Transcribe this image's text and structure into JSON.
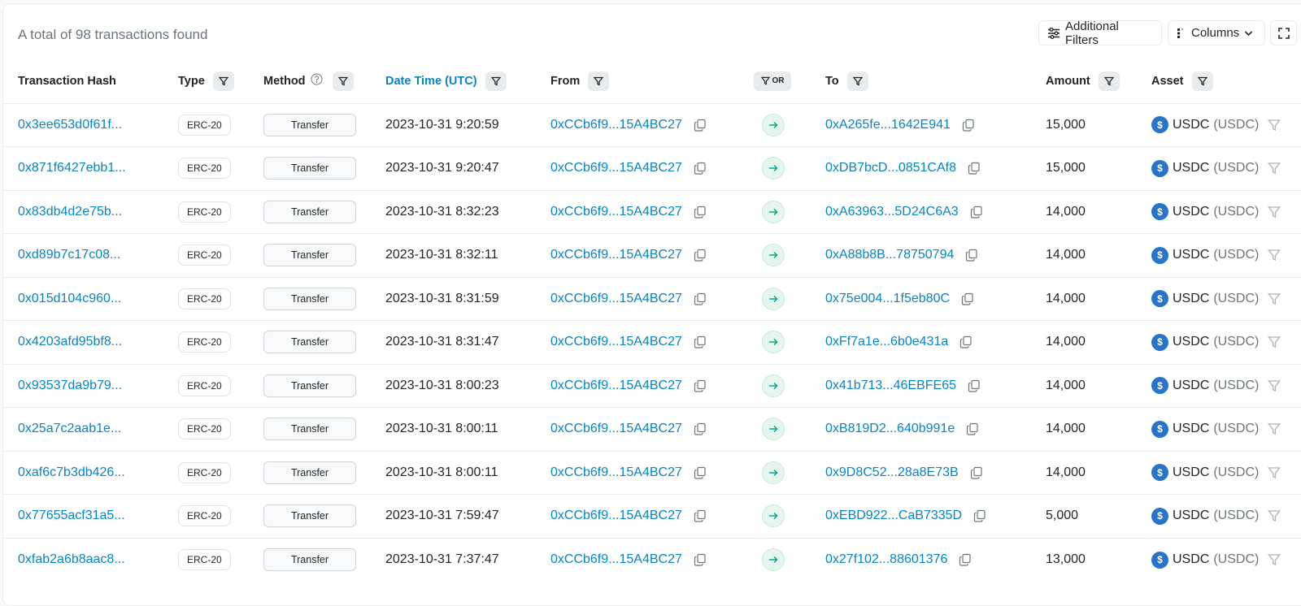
{
  "summary": "A total of 98 transactions found",
  "toolbar": {
    "filters_label": "Additional Filters",
    "columns_label": "Columns"
  },
  "headers": {
    "hash": "Transaction Hash",
    "type": "Type",
    "method": "Method",
    "datetime": "Date Time (UTC)",
    "from": "From",
    "or": "OR",
    "to": "To",
    "amount": "Amount",
    "asset": "Asset"
  },
  "asset": {
    "name": "USDC",
    "symbol": "(USDC)"
  },
  "icons": [
    "sliders-icon",
    "columns-icon",
    "chevron-down-icon",
    "expand-icon",
    "filter-icon",
    "help-icon",
    "copy-icon",
    "arrow-right-icon",
    "usdc-coin-icon"
  ],
  "colors": {
    "link": "#0784c3",
    "usdc": "#2775ca",
    "arrow_bg": "#e6f5ee"
  },
  "rows": [
    {
      "hash": "0x3ee653d0f61f...",
      "type": "ERC-20",
      "method": "Transfer",
      "datetime": "2023-10-31 9:20:59",
      "from": "0xCCb6f9...15A4BC27",
      "to": "0xA265fe...1642E941",
      "amount": "15,000"
    },
    {
      "hash": "0x871f6427ebb1...",
      "type": "ERC-20",
      "method": "Transfer",
      "datetime": "2023-10-31 9:20:47",
      "from": "0xCCb6f9...15A4BC27",
      "to": "0xDB7bcD...0851CAf8",
      "amount": "15,000"
    },
    {
      "hash": "0x83db4d2e75b...",
      "type": "ERC-20",
      "method": "Transfer",
      "datetime": "2023-10-31 8:32:23",
      "from": "0xCCb6f9...15A4BC27",
      "to": "0xA63963...5D24C6A3",
      "amount": "14,000"
    },
    {
      "hash": "0xd89b7c17c08...",
      "type": "ERC-20",
      "method": "Transfer",
      "datetime": "2023-10-31 8:32:11",
      "from": "0xCCb6f9...15A4BC27",
      "to": "0xA88b8B...78750794",
      "amount": "14,000"
    },
    {
      "hash": "0x015d104c960...",
      "type": "ERC-20",
      "method": "Transfer",
      "datetime": "2023-10-31 8:31:59",
      "from": "0xCCb6f9...15A4BC27",
      "to": "0x75e004...1f5eb80C",
      "amount": "14,000"
    },
    {
      "hash": "0x4203afd95bf8...",
      "type": "ERC-20",
      "method": "Transfer",
      "datetime": "2023-10-31 8:31:47",
      "from": "0xCCb6f9...15A4BC27",
      "to": "0xFf7a1e...6b0e431a",
      "amount": "14,000"
    },
    {
      "hash": "0x93537da9b79...",
      "type": "ERC-20",
      "method": "Transfer",
      "datetime": "2023-10-31 8:00:23",
      "from": "0xCCb6f9...15A4BC27",
      "to": "0x41b713...46EBFE65",
      "amount": "14,000"
    },
    {
      "hash": "0x25a7c2aab1e...",
      "type": "ERC-20",
      "method": "Transfer",
      "datetime": "2023-10-31 8:00:11",
      "from": "0xCCb6f9...15A4BC27",
      "to": "0xB819D2...640b991e",
      "amount": "14,000"
    },
    {
      "hash": "0xaf6c7b3db426...",
      "type": "ERC-20",
      "method": "Transfer",
      "datetime": "2023-10-31 8:00:11",
      "from": "0xCCb6f9...15A4BC27",
      "to": "0x9D8C52...28a8E73B",
      "amount": "14,000"
    },
    {
      "hash": "0x77655acf31a5...",
      "type": "ERC-20",
      "method": "Transfer",
      "datetime": "2023-10-31 7:59:47",
      "from": "0xCCb6f9...15A4BC27",
      "to": "0xEBD922...CaB7335D",
      "amount": "5,000"
    },
    {
      "hash": "0xfab2a6b8aac8...",
      "type": "ERC-20",
      "method": "Transfer",
      "datetime": "2023-10-31 7:37:47",
      "from": "0xCCb6f9...15A4BC27",
      "to": "0x27f102...88601376",
      "amount": "13,000"
    }
  ]
}
